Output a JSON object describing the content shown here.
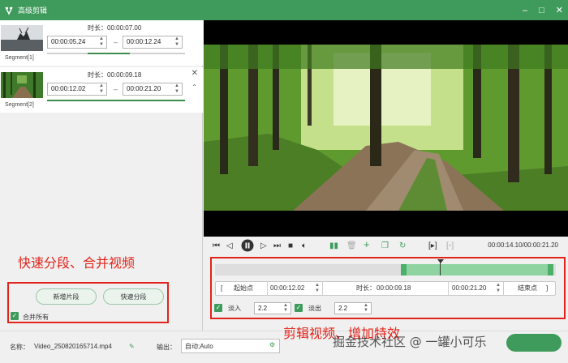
{
  "window": {
    "title": "高级剪辑",
    "minimize_icon": "minimize-icon",
    "maximize_icon": "maximize-icon",
    "close_icon": "close-icon"
  },
  "segments": [
    {
      "label": "Segment[1]",
      "duration_label": "时长：",
      "duration": "00:00:07.00",
      "start": "00:00:05.24",
      "end": "00:00:12.24",
      "progress": 0.3
    },
    {
      "label": "Segment[2]",
      "duration_label": "时长：",
      "duration": "00:00:09.18",
      "start": "00:00:12.02",
      "end": "00:00:21.20",
      "progress": 1.0
    }
  ],
  "segment_separator": "–",
  "annotations": {
    "left": "快速分段、合并视频",
    "right": "剪辑视频、增加特效"
  },
  "left_buttons": {
    "add_segment": "新增片段",
    "quick_split": "快速分段"
  },
  "merge_all": {
    "label": "合并所有",
    "checked": true
  },
  "player": {
    "timecode": "00:00:14.10/00:00:21.20",
    "position_fraction": 0.66
  },
  "editor": {
    "start_label": "起始点",
    "start_value": "00:00:12.02",
    "duration_label": "时长：",
    "duration_value": "00:00:09.18",
    "end_value": "00:00:21.20",
    "end_label": "结束点",
    "fade_in_label": "淡入",
    "fade_in_value": "2.2",
    "fade_out_label": "淡出",
    "fade_out_value": "2.2"
  },
  "bottom": {
    "name_label": "名称：",
    "name_value": "Video_250820165714.mp4",
    "output_label": "输出：",
    "output_value": "自动;Auto"
  },
  "watermark": "掘金技术社区 @ 一罐小可乐",
  "colors": {
    "accent": "#3f9b5c",
    "annotation": "#e2231a"
  }
}
